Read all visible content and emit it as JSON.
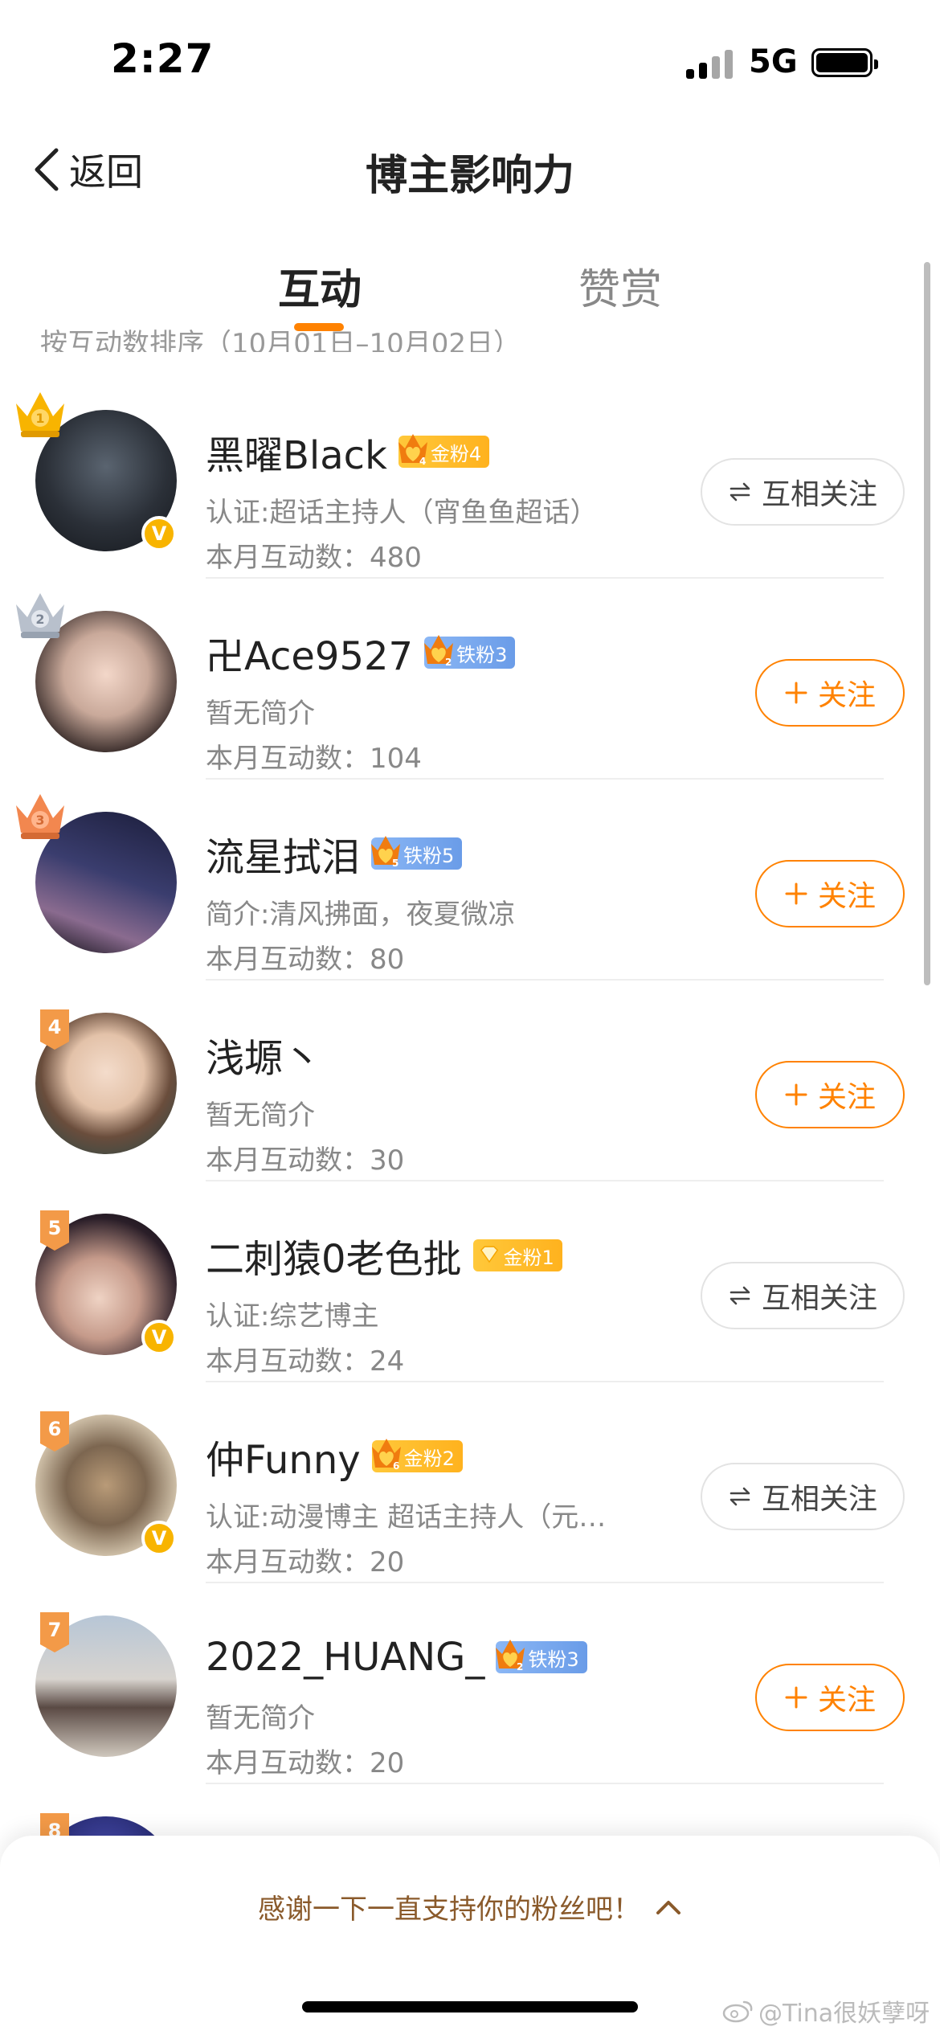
{
  "status_bar": {
    "time": "2:27",
    "network": "5G"
  },
  "nav": {
    "back_label": "返回",
    "title": "博主影响力"
  },
  "tabs": [
    {
      "label": "互动",
      "active": true
    },
    {
      "label": "赞赏",
      "active": false
    }
  ],
  "sort_hint": "按互动数排序（10月01日–10月02日）",
  "colors": {
    "accent": "#ff8200",
    "gold_badge": "#ffbe2e",
    "iron_badge": "#7aa9ef",
    "verified": "#f8b400"
  },
  "list": [
    {
      "rank": "1",
      "rank_style": "gold-crown",
      "name": "黑曜Black",
      "fan_badge": "金粉4",
      "fan_tier": "gold",
      "fan_level": "4",
      "verified": true,
      "desc": "认证:超话主持人（宵鱼鱼超话）",
      "count": "本月互动数：480",
      "button": "互相关注",
      "button_type": "mutual"
    },
    {
      "rank": "2",
      "rank_style": "silver-crown",
      "name": "卍Ace9527",
      "fan_badge": "铁粉3",
      "fan_tier": "iron",
      "fan_level": "2",
      "verified": false,
      "desc": "暂无简介",
      "count": "本月互动数：104",
      "button": "关注",
      "button_type": "follow"
    },
    {
      "rank": "3",
      "rank_style": "bronze-crown",
      "name": "流星拭泪",
      "fan_badge": "铁粉5",
      "fan_tier": "iron",
      "fan_level": "5",
      "verified": false,
      "desc": "简介:清风拂面，夜夏微凉",
      "count": "本月互动数：80",
      "button": "关注",
      "button_type": "follow"
    },
    {
      "rank": "4",
      "rank_style": "tag",
      "name": "浅塬丶",
      "fan_badge": "",
      "fan_tier": "",
      "fan_level": "",
      "verified": false,
      "desc": "暂无简介",
      "count": "本月互动数：30",
      "button": "关注",
      "button_type": "follow"
    },
    {
      "rank": "5",
      "rank_style": "tag",
      "name": "二刺猿0老色批",
      "fan_badge": "金粉1",
      "fan_tier": "gold",
      "fan_level": "",
      "verified": true,
      "desc": "认证:综艺博主",
      "count": "本月互动数：24",
      "button": "互相关注",
      "button_type": "mutual"
    },
    {
      "rank": "6",
      "rank_style": "tag",
      "name": "仲Funny",
      "fan_badge": "金粉2",
      "fan_tier": "gold",
      "fan_level": "6",
      "verified": true,
      "desc": "认证:动漫博主 超话主持人（元…",
      "count": "本月互动数：20",
      "button": "互相关注",
      "button_type": "mutual"
    },
    {
      "rank": "7",
      "rank_style": "tag",
      "name": "2022_HUANG_",
      "fan_badge": "铁粉3",
      "fan_tier": "iron",
      "fan_level": "2",
      "verified": false,
      "desc": "暂无简介",
      "count": "本月互动数：20",
      "button": "关注",
      "button_type": "follow"
    },
    {
      "rank": "8",
      "rank_style": "tag",
      "name": "",
      "fan_badge": "",
      "fan_tier": "gold",
      "fan_level": "",
      "verified": false,
      "desc": "",
      "count": "",
      "button": "",
      "button_type": ""
    }
  ],
  "bottom_sheet": {
    "text": "感谢一下一直支持你的粉丝吧！"
  },
  "watermark": "@Tina很妖孽呀"
}
